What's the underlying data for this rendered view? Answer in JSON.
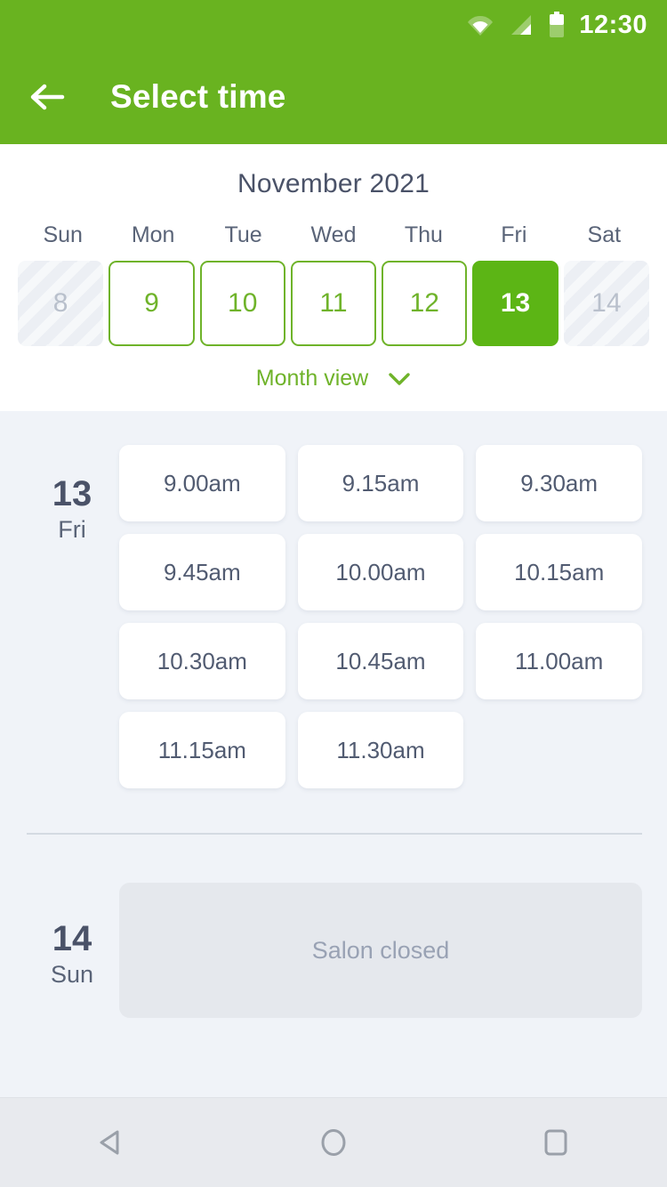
{
  "status_bar": {
    "time": "12:30",
    "icons": [
      "wifi-icon",
      "signal-icon",
      "battery-icon"
    ]
  },
  "app_bar": {
    "back_icon": "back-arrow-icon",
    "title": "Select time",
    "background_color": "#69b320"
  },
  "calendar": {
    "month_label": "November 2021",
    "weekdays": [
      "Sun",
      "Mon",
      "Tue",
      "Wed",
      "Thu",
      "Fri",
      "Sat"
    ],
    "days": [
      {
        "number": "8",
        "state": "disabled"
      },
      {
        "number": "9",
        "state": "available"
      },
      {
        "number": "10",
        "state": "available"
      },
      {
        "number": "11",
        "state": "available"
      },
      {
        "number": "12",
        "state": "available"
      },
      {
        "number": "13",
        "state": "selected"
      },
      {
        "number": "14",
        "state": "disabled"
      }
    ],
    "view_toggle_label": "Month view",
    "view_toggle_icon": "chevron-down-icon",
    "accent_color": "#6fb32a",
    "selected_color": "#5cb515"
  },
  "day_groups": [
    {
      "day_number": "13",
      "day_of_week": "Fri",
      "slots": [
        "9.00am",
        "9.15am",
        "9.30am",
        "9.45am",
        "10.00am",
        "10.15am",
        "10.30am",
        "10.45am",
        "11.00am",
        "11.15am",
        "11.30am"
      ]
    },
    {
      "day_number": "14",
      "day_of_week": "Sun",
      "closed_message": "Salon closed"
    }
  ],
  "nav_bar": {
    "back_icon": "nav-back-triangle-icon",
    "home_icon": "nav-home-circle-icon",
    "recents_icon": "nav-recents-square-icon"
  }
}
